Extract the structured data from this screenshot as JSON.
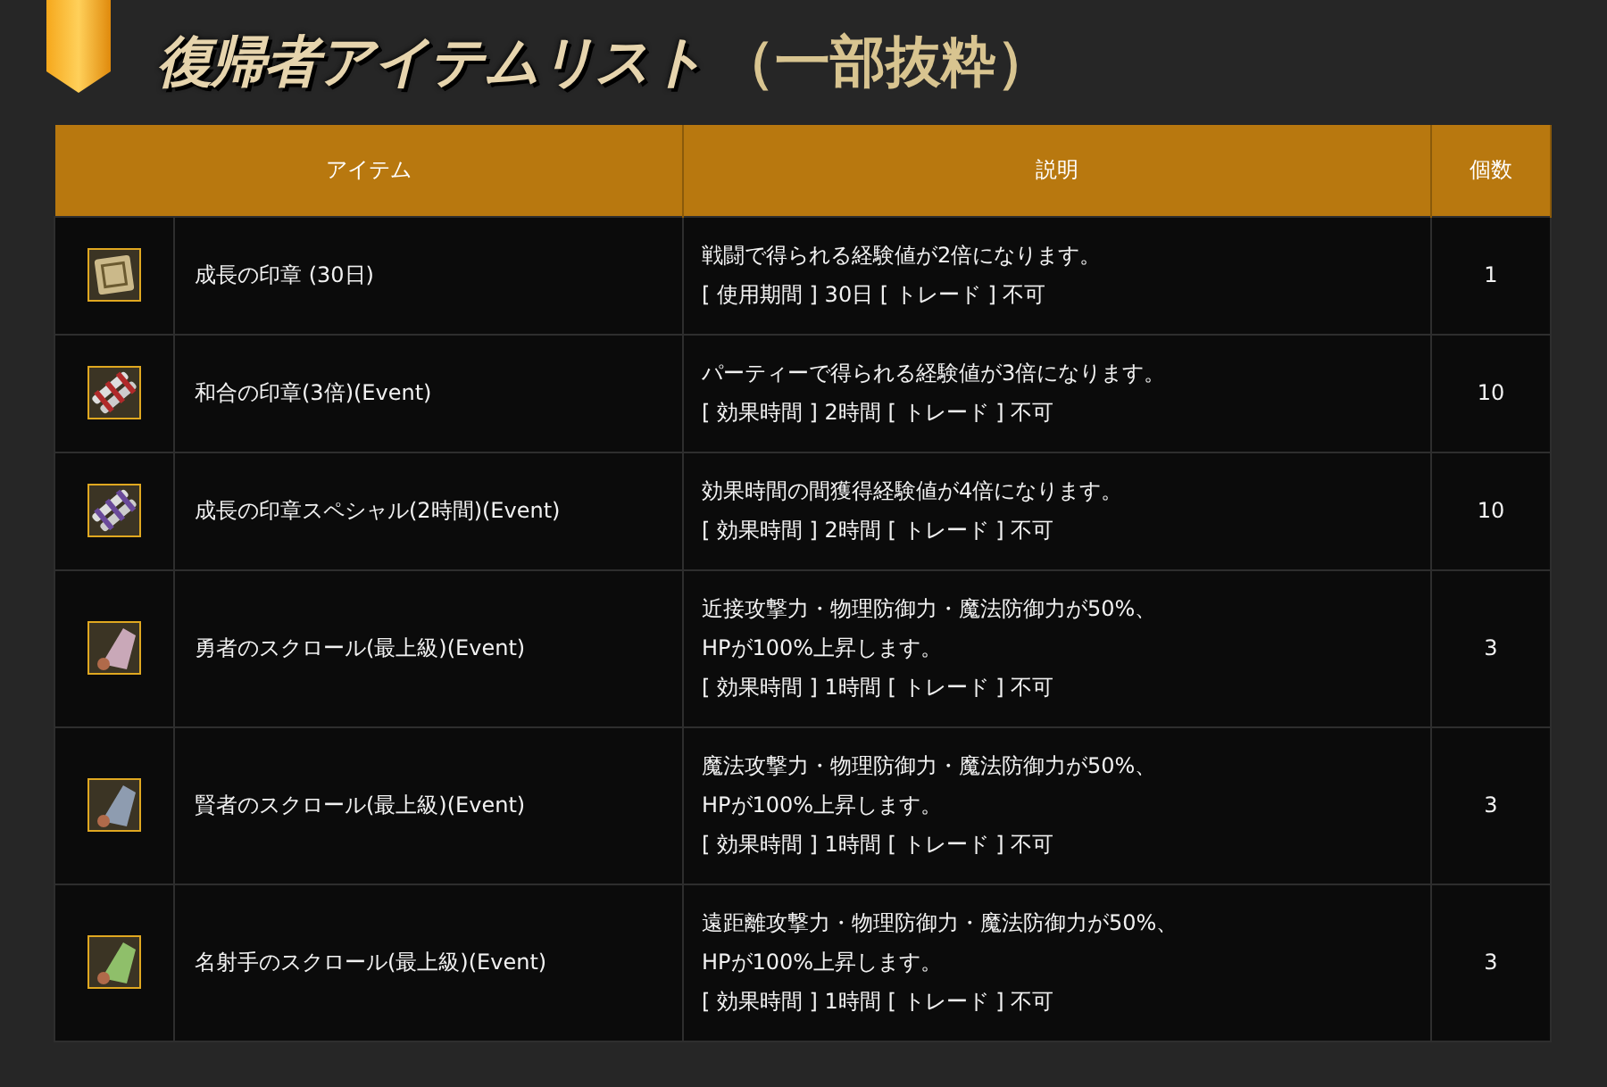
{
  "title": {
    "main": "復帰者アイテムリスト",
    "sub": "（一部抜粋）"
  },
  "table": {
    "columns": [
      "アイテム",
      "説明",
      "個数"
    ],
    "rows": [
      {
        "icon": {
          "kind": "seal",
          "color": "#cbb98a"
        },
        "name": "成長の印章 (30日)",
        "description": [
          "戦闘で得られる経験値が2倍になります。",
          "[ 使用期間 ] 30日 [ トレード ] 不可"
        ],
        "count": "1"
      },
      {
        "icon": {
          "kind": "bundle",
          "color": "#b02a2a"
        },
        "name": "和合の印章(3倍)(Event)",
        "description": [
          "パーティーで得られる経験値が3倍になります。",
          "[ 効果時間 ] 2時間 [ トレード ] 不可"
        ],
        "count": "10"
      },
      {
        "icon": {
          "kind": "bundle",
          "color": "#6a4a9a"
        },
        "name": "成長の印章スペシャル(2時間)(Event)",
        "description": [
          "効果時間の間獲得経験値が4倍になります。",
          "[ 効果時間 ] 2時間 [ トレード ] 不可"
        ],
        "count": "10"
      },
      {
        "icon": {
          "kind": "scroll",
          "color": "#c9a8b8"
        },
        "name": "勇者のスクロール(最上級)(Event)",
        "description": [
          "近接攻撃力・物理防御力・魔法防御力が50%、",
          "HPが100%上昇します。",
          "[ 効果時間 ] 1時間 [ トレード ] 不可"
        ],
        "count": "3"
      },
      {
        "icon": {
          "kind": "scroll",
          "color": "#8e9cb0"
        },
        "name": "賢者のスクロール(最上級)(Event)",
        "description": [
          "魔法攻撃力・物理防御力・魔法防御力が50%、",
          "HPが100%上昇します。",
          "[ 効果時間 ] 1時間 [ トレード ] 不可"
        ],
        "count": "3"
      },
      {
        "icon": {
          "kind": "scroll",
          "color": "#8fbf6a"
        },
        "name": "名射手のスクロール(最上級)(Event)",
        "description": [
          "遠距離攻撃力・物理防御力・魔法防御力が50%、",
          "HPが100%上昇します。",
          "[ 効果時間 ] 1時間 [ トレード ] 不可"
        ],
        "count": "3"
      }
    ]
  }
}
